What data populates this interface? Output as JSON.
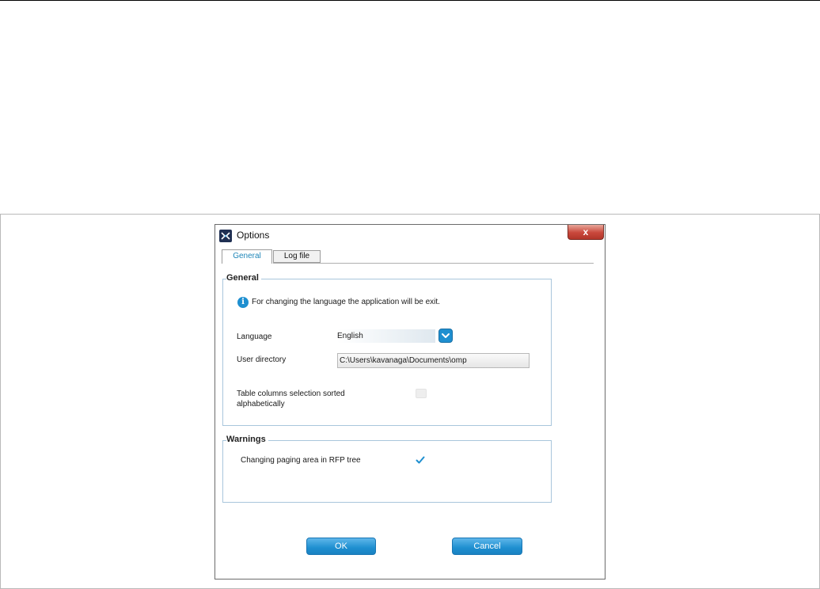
{
  "window": {
    "title": "Options",
    "close_glyph": "x"
  },
  "tabs": [
    {
      "label": "General",
      "active": true
    },
    {
      "label": "Log file",
      "active": false
    }
  ],
  "general_group": {
    "legend": "General",
    "info_text": "For changing the language the application will be exit.",
    "language_label": "Language",
    "language_value": "English",
    "user_directory_label": "User directory",
    "user_directory_value": "C:\\Users\\kavanaga\\Documents\\omp",
    "table_columns_label_line1": "Table columns selection sorted",
    "table_columns_label_line2": "alphabetically",
    "table_columns_checked": false
  },
  "warnings_group": {
    "legend": "Warnings",
    "paging_label": "Changing paging area in RFP tree",
    "paging_checked": true
  },
  "buttons": {
    "ok": "OK",
    "cancel": "Cancel"
  },
  "colors": {
    "accent": "#1e8fd0",
    "group_border": "#a9c6dc",
    "close_button": "#c9473b"
  },
  "icons": {
    "app": "app-logo-icon",
    "info": "info-icon",
    "dropdown": "chevron-down-icon",
    "check": "checkmark-icon",
    "close": "close-icon"
  }
}
